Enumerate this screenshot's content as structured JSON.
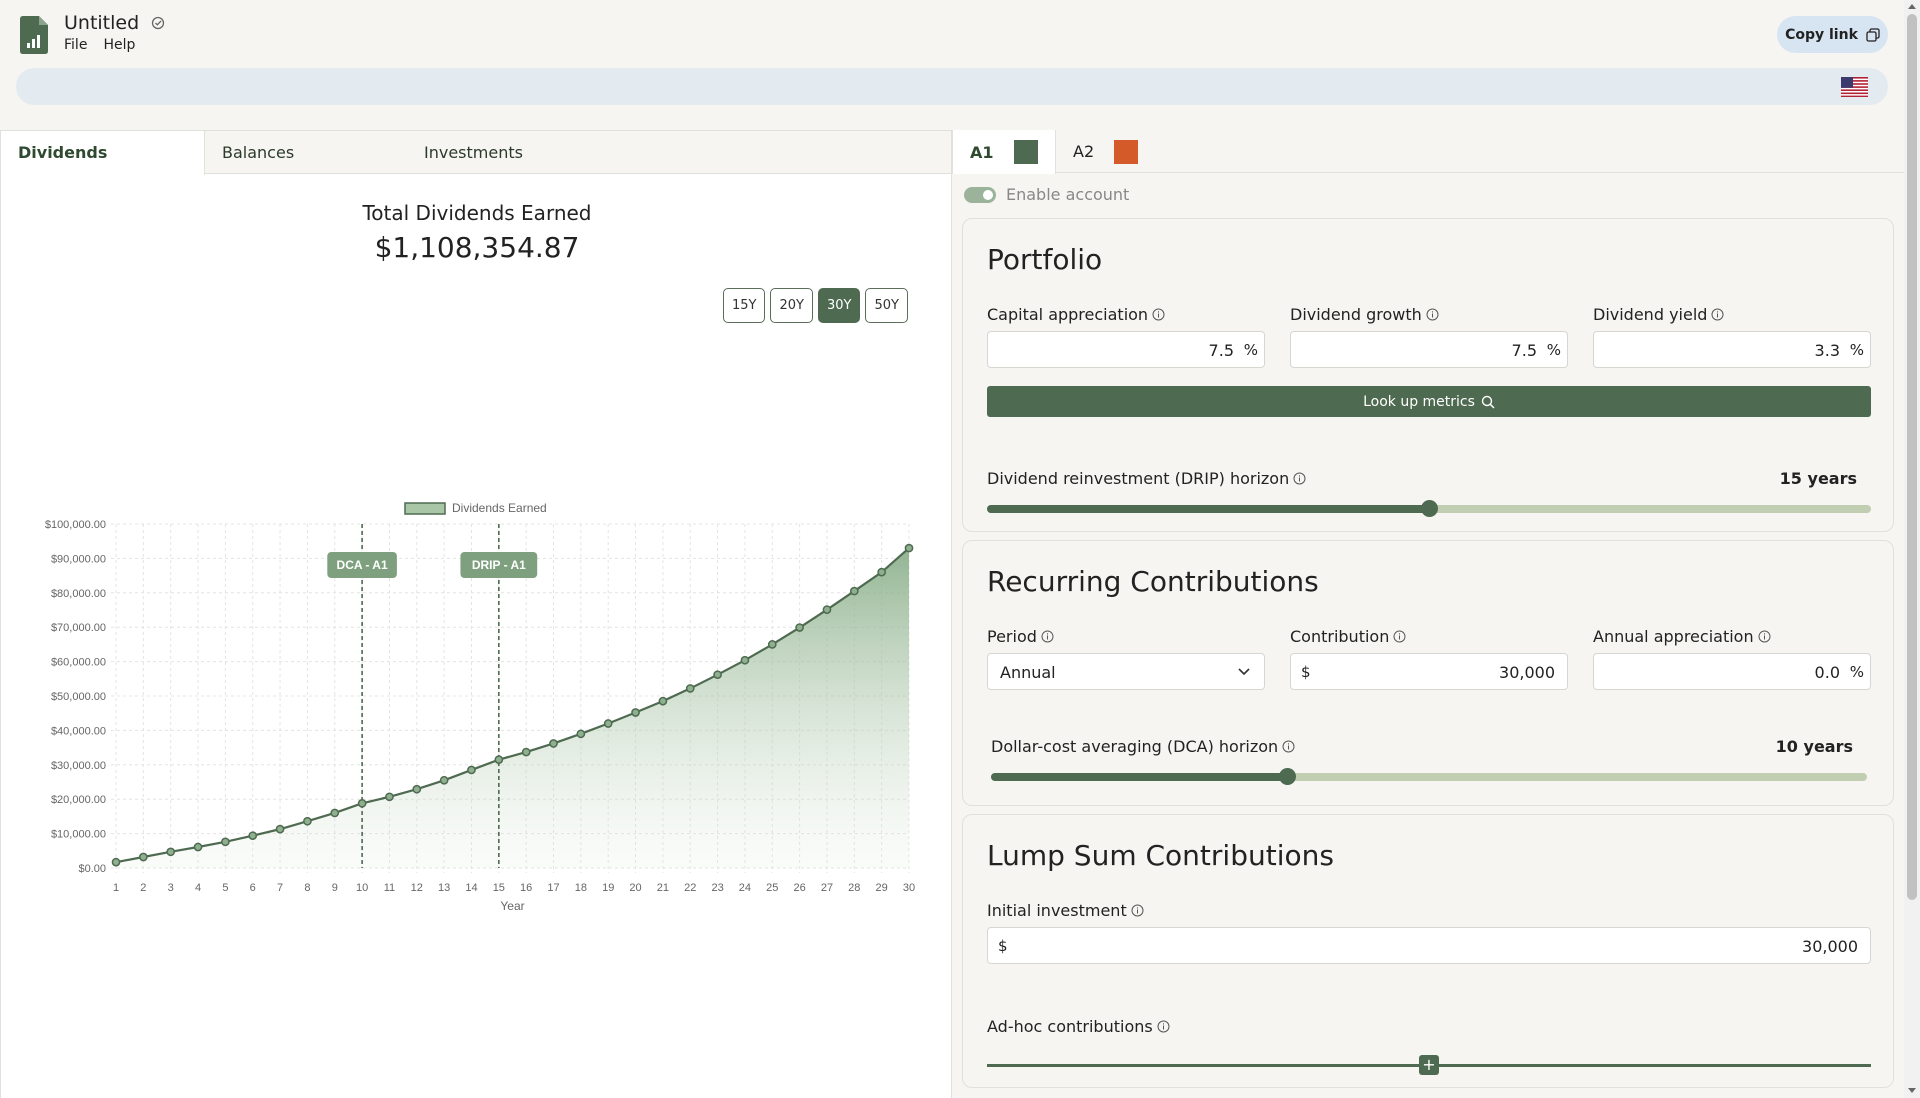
{
  "header": {
    "doc_title": "Untitled",
    "menu": [
      "File",
      "Help"
    ],
    "copy_link_label": "Copy link"
  },
  "left_tabs": [
    "Dividends",
    "Balances",
    "Investments"
  ],
  "summary": {
    "title": "Total Dividends Earned",
    "total": "$1,108,354.87"
  },
  "range_buttons": [
    "15Y",
    "20Y",
    "30Y",
    "50Y"
  ],
  "range_selected": "30Y",
  "chart_data": {
    "type": "area",
    "legend": [
      "Dividends Earned"
    ],
    "legend_position": "top",
    "xlabel": "Year",
    "ylabel": "",
    "x": [
      1,
      2,
      3,
      4,
      5,
      6,
      7,
      8,
      9,
      10,
      11,
      12,
      13,
      14,
      15,
      16,
      17,
      18,
      19,
      20,
      21,
      22,
      23,
      24,
      25,
      26,
      27,
      28,
      29,
      30
    ],
    "ylim": [
      0,
      100000
    ],
    "yticks": [
      "$0.00",
      "$10,000.00",
      "$20,000.00",
      "$30,000.00",
      "$40,000.00",
      "$50,000.00",
      "$60,000.00",
      "$70,000.00",
      "$80,000.00",
      "$90,000.00",
      "$100,000.00"
    ],
    "series": [
      {
        "name": "Dividends Earned",
        "color": "#4e6a50",
        "values": [
          1700,
          3200,
          4700,
          6100,
          7600,
          9400,
          11300,
          13600,
          16000,
          18800,
          20700,
          22900,
          25500,
          28500,
          31500,
          33700,
          36200,
          39000,
          42000,
          45200,
          48500,
          52200,
          56200,
          60400,
          65000,
          69900,
          75100,
          80500,
          86000,
          93000
        ]
      }
    ],
    "annotations": [
      {
        "label": "DCA - A1",
        "x": 10
      },
      {
        "label": "DRIP - A1",
        "x": 15
      }
    ],
    "grid": true
  },
  "accounts": [
    {
      "label": "A1",
      "color": "#4e6a50"
    },
    {
      "label": "A2",
      "color": "#d55a2a"
    }
  ],
  "enable_account_label": "Enable account",
  "portfolio": {
    "title": "Portfolio",
    "capital_appreciation_label": "Capital appreciation",
    "capital_appreciation": "7.5",
    "dividend_growth_label": "Dividend growth",
    "dividend_growth": "7.5",
    "dividend_yield_label": "Dividend yield",
    "dividend_yield": "3.3",
    "percent": "%",
    "lookup_label": "Look up metrics",
    "drip_label": "Dividend reinvestment (DRIP) horizon",
    "drip_value": "15 years",
    "drip_fraction": 0.5
  },
  "recurring": {
    "title": "Recurring Contributions",
    "period_label": "Period",
    "period_value": "Annual",
    "contribution_label": "Contribution",
    "currency": "$",
    "contribution_value": "30,000",
    "annual_appreciation_label": "Annual appreciation",
    "annual_appreciation": "0.0",
    "percent": "%",
    "dca_label": "Dollar-cost averaging (DCA) horizon",
    "dca_value": "10 years",
    "dca_fraction": 0.338
  },
  "lump_sum": {
    "title": "Lump Sum Contributions",
    "initial_label": "Initial investment",
    "currency": "$",
    "initial_value": "30,000",
    "adhoc_label": "Ad-hoc contributions"
  }
}
